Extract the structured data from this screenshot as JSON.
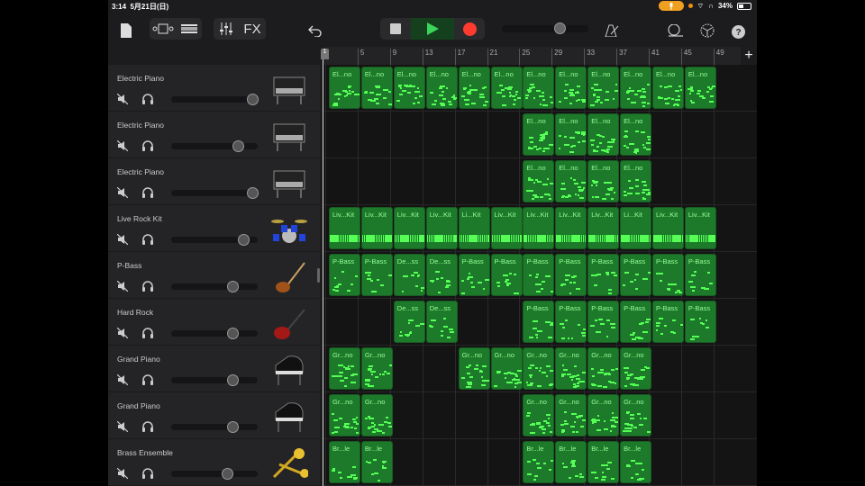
{
  "status": {
    "time": "3:14",
    "date": "5月21日(日)",
    "battery": "34%"
  },
  "toolbar": {
    "fx_label": "FX"
  },
  "ruler": {
    "bars": [
      "1",
      "5",
      "9",
      "13",
      "17",
      "21",
      "25",
      "29",
      "33",
      "37",
      "41",
      "45",
      "49"
    ]
  },
  "colors": {
    "region": "#1c7a2a",
    "note": "#55ff55",
    "play": "#3ad65a",
    "record": "#ff3b30"
  },
  "tracks": [
    {
      "name": "Electric Piano",
      "instrument": "electric-piano",
      "volume": 0.95,
      "regions": [
        [
          0,
          "El...no"
        ],
        [
          1,
          "El...no"
        ],
        [
          2,
          "El...no"
        ],
        [
          3,
          "El...no"
        ],
        [
          4,
          "El...no"
        ],
        [
          5,
          "El...no"
        ],
        [
          6,
          "El...no"
        ],
        [
          7,
          "El...no"
        ],
        [
          8,
          "El...no"
        ],
        [
          9,
          "El...no"
        ],
        [
          10,
          "El...no"
        ],
        [
          11,
          "El...no"
        ]
      ]
    },
    {
      "name": "Electric Piano",
      "instrument": "electric-piano",
      "volume": 0.76,
      "regions": [
        [
          6,
          "El...no"
        ],
        [
          7,
          "El...no"
        ],
        [
          8,
          "El...no"
        ],
        [
          9,
          "El...no"
        ]
      ]
    },
    {
      "name": "Electric Piano",
      "instrument": "electric-piano",
      "volume": 0.95,
      "regions": [
        [
          6,
          "El...no"
        ],
        [
          7,
          "El...no"
        ],
        [
          8,
          "El...no"
        ],
        [
          9,
          "El...no"
        ]
      ]
    },
    {
      "name": "Live Rock Kit",
      "instrument": "drum-kit",
      "volume": 0.83,
      "regions": [
        [
          0,
          "Liv...Kit"
        ],
        [
          1,
          "Liv...Kit"
        ],
        [
          2,
          "Liv...Kit"
        ],
        [
          3,
          "Liv...Kit"
        ],
        [
          4,
          "Li...Kit"
        ],
        [
          5,
          "Liv...Kit"
        ],
        [
          6,
          "Liv...Kit"
        ],
        [
          7,
          "Liv...Kit"
        ],
        [
          8,
          "Liv...Kit"
        ],
        [
          9,
          "Li...Kit"
        ],
        [
          10,
          "Liv...Kit"
        ],
        [
          11,
          "Liv...Kit"
        ]
      ]
    },
    {
      "name": "P-Bass",
      "instrument": "bass-guitar",
      "volume": 0.69,
      "regions": [
        [
          0,
          "P-Bass"
        ],
        [
          1,
          "P-Bass"
        ],
        [
          2,
          "De...ss"
        ],
        [
          3,
          "De...ss"
        ],
        [
          4,
          "P-Bass"
        ],
        [
          5,
          "P-Bass"
        ],
        [
          6,
          "P-Bass"
        ],
        [
          7,
          "P-Bass"
        ],
        [
          8,
          "P-Bass"
        ],
        [
          9,
          "P-Bass"
        ],
        [
          10,
          "P-Bass"
        ],
        [
          11,
          "P-Bass"
        ]
      ]
    },
    {
      "name": "Hard Rock",
      "instrument": "electric-guitar",
      "volume": 0.69,
      "regions": [
        [
          2,
          "De...ss"
        ],
        [
          3,
          "De...ss"
        ],
        [
          6,
          "P-Bass"
        ],
        [
          7,
          "P-Bass"
        ],
        [
          8,
          "P-Bass"
        ],
        [
          9,
          "P-Bass"
        ],
        [
          10,
          "P-Bass"
        ],
        [
          11,
          "P-Bass"
        ]
      ]
    },
    {
      "name": "Grand Piano",
      "instrument": "grand-piano",
      "volume": 0.69,
      "regions": [
        [
          0,
          "Gr...no"
        ],
        [
          1,
          "Gr...no"
        ],
        [
          4,
          "Gr...no"
        ],
        [
          5,
          "Gr...no"
        ],
        [
          6,
          "Gr...no"
        ],
        [
          7,
          "Gr...no"
        ],
        [
          8,
          "Gr...no"
        ],
        [
          9,
          "Gr...no"
        ]
      ]
    },
    {
      "name": "Grand Piano",
      "instrument": "grand-piano",
      "volume": 0.69,
      "regions": [
        [
          0,
          "Gr...no"
        ],
        [
          1,
          "Gr...no"
        ],
        [
          6,
          "Gr...no"
        ],
        [
          7,
          "Gr...no"
        ],
        [
          8,
          "Gr...no"
        ],
        [
          9,
          "Gr...no"
        ]
      ]
    },
    {
      "name": "Brass Ensemble",
      "instrument": "brass",
      "volume": 0.62,
      "regions": [
        [
          0,
          "Br...le"
        ],
        [
          1,
          "Br...le"
        ],
        [
          6,
          "Br...le"
        ],
        [
          7,
          "Br...le"
        ],
        [
          8,
          "Br...le"
        ],
        [
          9,
          "Br...le"
        ]
      ]
    }
  ]
}
